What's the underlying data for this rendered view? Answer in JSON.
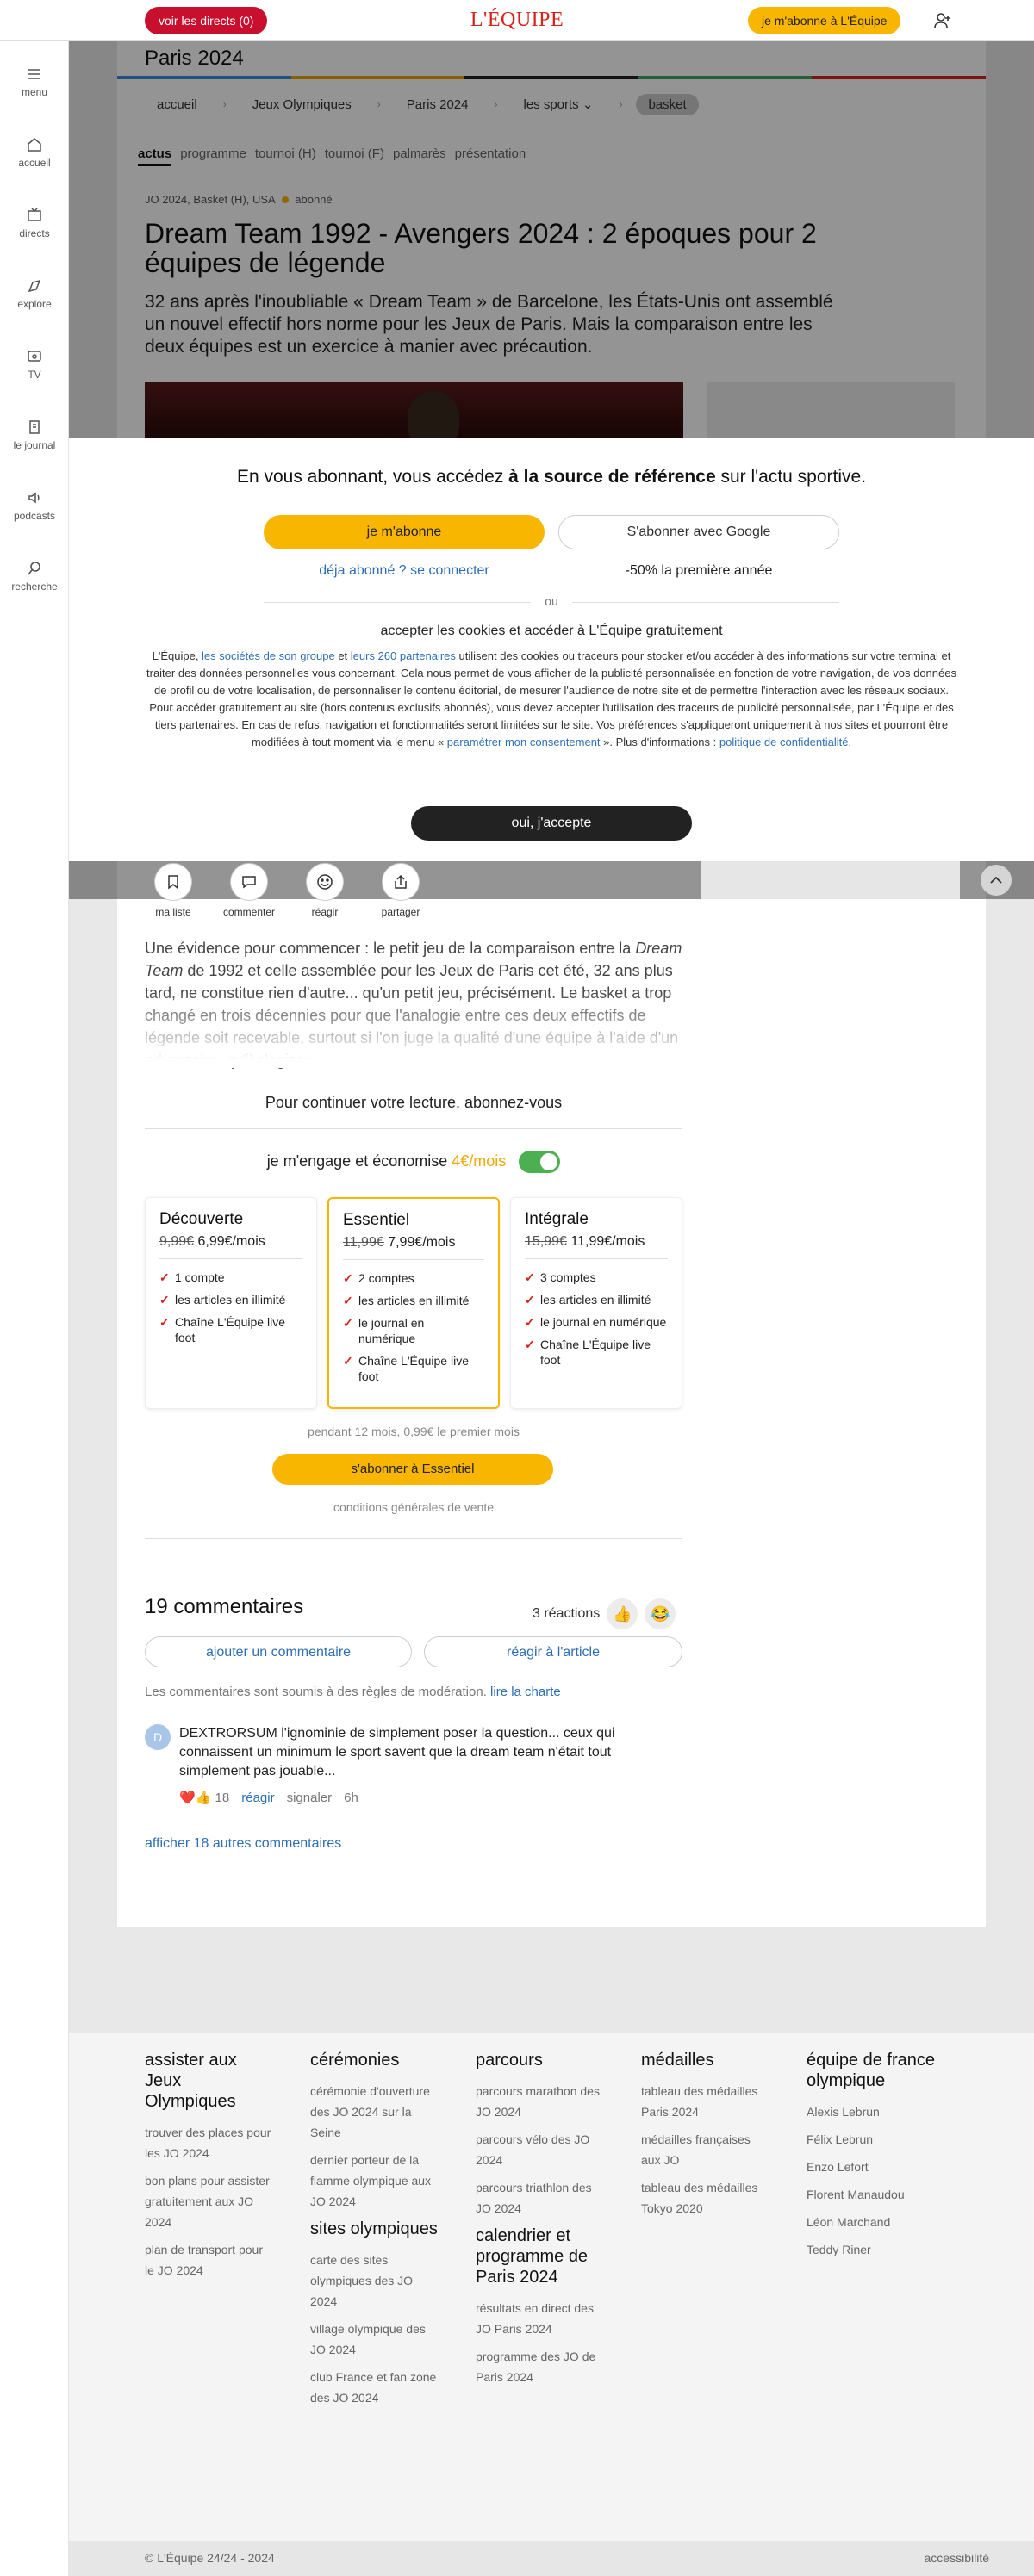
{
  "topbar": {
    "directs_label": "voir les directs (0)",
    "logo": "L'ÉQUIPE",
    "subscribe_label": "je m'abonne à L'Équipe"
  },
  "sidebar": [
    {
      "label": "menu",
      "icon": "menu-icon"
    },
    {
      "label": "accueil",
      "icon": "home-icon"
    },
    {
      "label": "directs",
      "icon": "live-icon"
    },
    {
      "label": "explore",
      "icon": "explore-icon"
    },
    {
      "label": "TV",
      "icon": "tv-icon"
    },
    {
      "label": "le journal",
      "icon": "newspaper-icon"
    },
    {
      "label": "podcasts",
      "icon": "podcast-icon"
    },
    {
      "label": "recherche",
      "icon": "search-icon"
    }
  ],
  "section": {
    "title": "Paris 2024",
    "colors": [
      "#3b8bd8",
      "#e6a400",
      "#222222",
      "#3fa65a",
      "#d5221a"
    ]
  },
  "breadcrumb": [
    "accueil",
    "Jeux Olympiques",
    "Paris 2024",
    "les sports",
    "basket"
  ],
  "tabs": [
    "actus",
    "programme",
    "tournoi (H)",
    "tournoi (F)",
    "palmarès",
    "présentation"
  ],
  "article": {
    "kicker": "JO 2024, Basket (H), USA",
    "badge": "abonné",
    "headline": "Dream Team 1992 - Avengers 2024 : 2 époques pour 2 équipes de légende",
    "standfirst": "32 ans après l'inoubliable « Dream Team » de Barcelone, les États-Unis ont assemblé un nouvel effectif hors norme pour les Jeux de Paris. Mais la comparaison entre les deux équipes est un exercice à manier avec précaution.",
    "body_p1_a": "Une évidence pour commencer : le petit jeu de la comparaison entre la ",
    "body_p1_em": "Dream Team",
    "body_p1_b": " de 1992 et celle assemblée pour les Jeux de Paris cet été, 32 ans plus tard, ne constitue rien d'autre... qu'un petit jeu, précisément. Le basket a trop changé en trois décennies pour que l'analogie entre ces deux effectifs de légende soit recevable, surtout si l'on juge la qualité d'une équipe à l'aide d'un adversaire, qu'il s'agisse..."
  },
  "actions": [
    {
      "label": "ma liste",
      "icon": "bookmark-icon"
    },
    {
      "label": "commenter",
      "icon": "comment-icon"
    },
    {
      "label": "réagir",
      "icon": "smiley-icon"
    },
    {
      "label": "partager",
      "icon": "share-icon"
    }
  ],
  "consent": {
    "lead_a": "En vous abonnant, vous accédez ",
    "lead_b": "à la source de référence",
    "lead_c": " sur l'actu sportive.",
    "subscribe": "je m'abonne",
    "google": "S'abonner avec Google",
    "login": "déja abonné ? se connecter",
    "discount": "-50% la première année",
    "or": "ou",
    "accept_title": "accepter les cookies et accéder à L'Équipe gratuitement",
    "legal_1": "L'Équipe, ",
    "legal_link_group": "les sociétés de son groupe",
    "legal_2": " et ",
    "legal_link_partners": "leurs 260 partenaires",
    "legal_3": " utilisent des cookies ou traceurs pour stocker et/ou accéder à des informations sur votre terminal et traiter des données personnelles vous concernant. Cela nous permet de vous afficher de la publicité personnalisée en fonction de votre navigation, de vos données de profil ou de votre localisation, de personnaliser le contenu éditorial, de mesurer l'audience de notre site et de permettre l'interaction avec les réseaux sociaux. Pour accéder gratuitement au site (hors contenus exclusifs abonnés), vous devez accepter l'utilisation des traceurs de publicité personnalisée, par L'Équipe et des tiers partenaires. En cas de refus, navigation et fonctionnalités seront limitées sur le site. Vos préférences s'appliqueront uniquement à nos sites et pourront être modifiées à tout moment via le menu « ",
    "legal_link_settings": "paramétrer mon consentement",
    "legal_4": " ». Plus d'informations : ",
    "legal_link_privacy": "politique de confidentialité",
    "legal_5": ".",
    "accept_button": "oui, j'accepte"
  },
  "paywall": {
    "title": "Pour continuer votre lecture, abonnez-vous",
    "engage": "je m'engage et économise ",
    "engage_price": "4€/mois",
    "plans": [
      {
        "name": "Découverte",
        "old_price": "9,99€",
        "price": " 6,99€/mois",
        "features": [
          "1 compte",
          "les articles en illimité",
          "Chaîne L'Équipe live foot"
        ]
      },
      {
        "name": "Essentiel",
        "old_price": "11,99€",
        "price": " 7,99€/mois",
        "features": [
          "2 comptes",
          "les articles en illimité",
          "le journal en numérique",
          "Chaîne L'Équipe live foot"
        ]
      },
      {
        "name": "Intégrale",
        "old_price": "15,99€",
        "price": " 11,99€/mois",
        "features": [
          "3 comptes",
          "les articles en illimité",
          "le journal en numérique",
          "Chaîne L'Équipe live foot"
        ]
      }
    ],
    "period": "pendant 12 mois, 0,99€ le premier mois",
    "cta": "s'abonner à Essentiel",
    "cgv": "conditions générales de vente"
  },
  "comments": {
    "title": "19 commentaires",
    "reactions": "3 réactions",
    "add": "ajouter un commentaire",
    "react": "réagir à l'article",
    "moderation": "Les commentaires sont soumis à des règles de modération. ",
    "charter": "lire la charte",
    "first": {
      "avatar": "D",
      "text": "DEXTRORSUM l'ignominie de simplement poser la question... ceux qui connaissent un minimum le sport savent que la dream team n'était tout simplement pas jouable...",
      "likes": "18",
      "reply": "réagir",
      "report": "signaler",
      "time": "6h"
    },
    "more": "afficher 18 autres commentaires"
  },
  "footer": {
    "columns": [
      {
        "title": "assister aux Jeux Olympiques",
        "links": [
          "trouver des places pour les JO 2024",
          "bon plans pour assister gratuitement aux JO 2024",
          "plan de transport pour le JO 2024"
        ]
      },
      {
        "title": "cérémonies",
        "links": [
          "cérémonie d'ouverture des JO 2024 sur la Seine",
          "dernier porteur de la flamme olympique aux JO 2024"
        ]
      },
      {
        "title": "sites olympiques",
        "links": [
          "carte des sites olympiques des JO 2024",
          "village olympique des JO 2024",
          "club France et fan zone des JO 2024"
        ]
      },
      {
        "title": "parcours",
        "links": [
          "parcours marathon des JO 2024",
          "parcours vélo des JO 2024",
          "parcours triathlon des JO 2024"
        ]
      },
      {
        "title": "calendrier et programme de Paris 2024",
        "links": [
          "résultats en direct des JO Paris 2024",
          "programme des JO de Paris 2024"
        ]
      },
      {
        "title": "médailles",
        "links": [
          "tableau des médailles Paris 2024",
          "médailles françaises aux JO",
          "tableau des médailles Tokyo 2020"
        ]
      },
      {
        "title": "équipe de france olympique",
        "links": [
          "Alexis Lebrun",
          "Félix Lebrun",
          "Enzo Lefort",
          "Florent Manaudou",
          "Léon Marchand",
          "Teddy Riner"
        ]
      }
    ],
    "copyright": "© L'Équipe 24/24 - 2024",
    "accessibility": "accessibilité"
  }
}
